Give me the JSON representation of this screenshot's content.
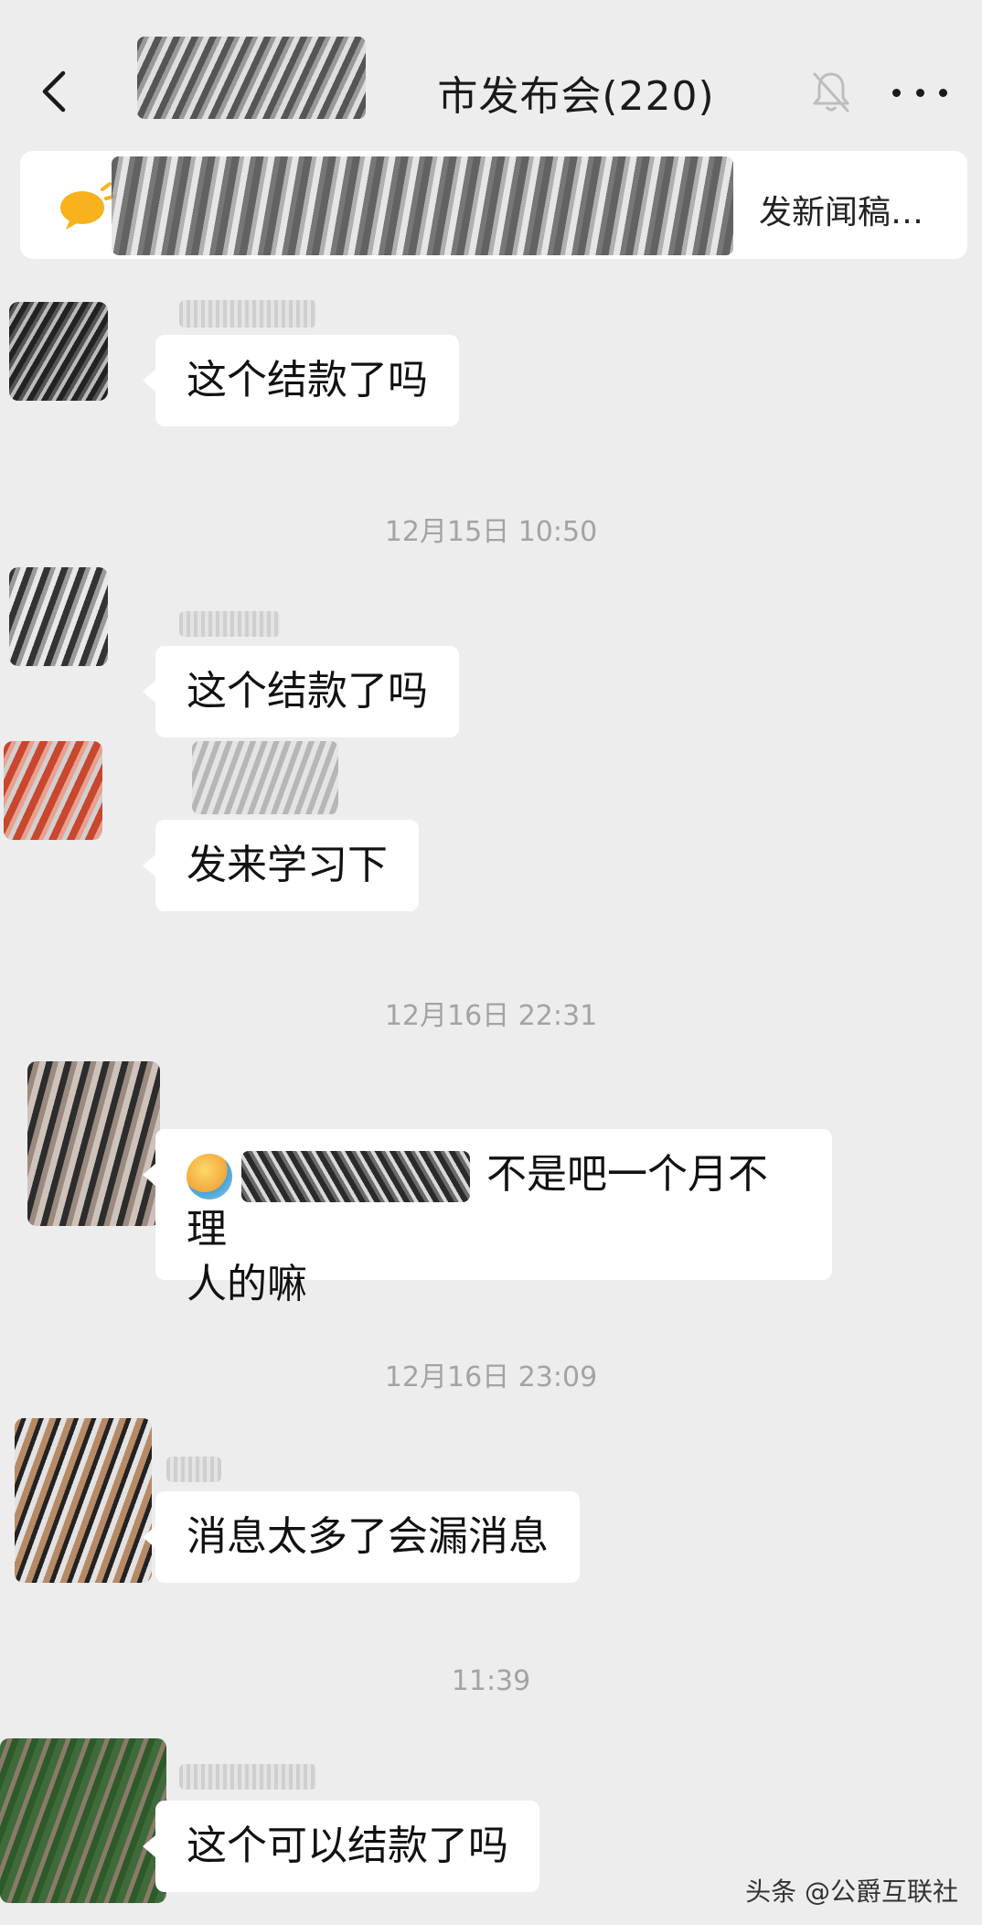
{
  "header": {
    "title": "市发布会(220)",
    "back_icon": "chevron-left-icon",
    "mute_icon": "bell-muted-icon",
    "more_icon": "more-horizontal-icon"
  },
  "announcement": {
    "icon": "megaphone-icon",
    "text": "发新闻稿…"
  },
  "messages": [
    {
      "text": "这个结款了吗"
    },
    {
      "time": "12月15日 10:50"
    },
    {
      "text": "这个结款了吗"
    },
    {
      "text": "发来学习下"
    },
    {
      "time": "12月16日 22:31"
    },
    {
      "text_line1": "不是吧一个月不理",
      "text_line2": "人的嘛"
    },
    {
      "time": "12月16日 23:09"
    },
    {
      "text": "消息太多了会漏消息"
    },
    {
      "time": "11:39"
    },
    {
      "text": "这个可以结款了吗"
    }
  ],
  "watermark": "头条 @公爵互联社",
  "colors": {
    "background": "#ededed",
    "bubble": "#ffffff",
    "timestamp": "#a3a3a3"
  }
}
